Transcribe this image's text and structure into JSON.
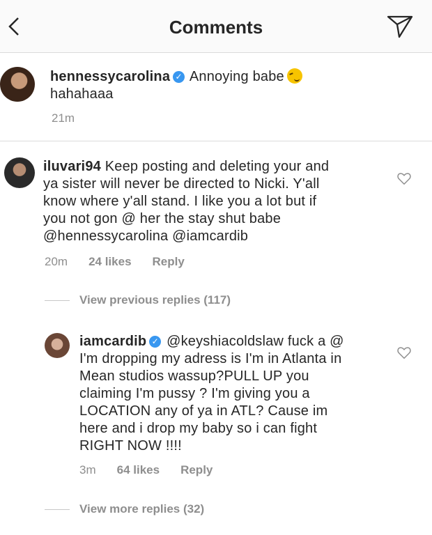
{
  "header": {
    "title": "Comments",
    "back_icon": "chevron-left-icon",
    "send_icon": "paper-plane-icon"
  },
  "caption": {
    "username": "hennessycarolina",
    "text_line1": "Annoying babe",
    "text_line2": "hahahaaa",
    "time": "21m"
  },
  "comments": [
    {
      "username": "iluvari94",
      "lines": [
        "Keep posting and deleting your and",
        "ya sister will never be directed to Nicki. Y'all",
        "know where y'all stand. I like you a lot but if",
        "you not gon @ her the stay shut babe",
        "@hennessycarolina @iamcardib"
      ],
      "time": "20m",
      "likes": "24 likes",
      "reply": "Reply",
      "view_replies": "View previous replies (117)"
    },
    {
      "username": "iamcardib",
      "lines": [
        "@keyshiacoldslaw fuck a @",
        "I'm dropping my adress is I'm in Atlanta in",
        "Mean studios wassup?PULL UP you",
        "claiming I'm pussy ? I'm giving you a",
        "LOCATION any of ya in ATL? Cause im",
        "here and i drop my baby so i can fight",
        "RIGHT NOW !!!!"
      ],
      "time": "3m",
      "likes": "64 likes",
      "reply": "Reply",
      "view_replies": "View more replies (32)"
    }
  ],
  "colors": {
    "text": "#262626",
    "secondary": "#8e8e8e",
    "verified": "#3897f0",
    "divider": "#dbdbdb"
  }
}
